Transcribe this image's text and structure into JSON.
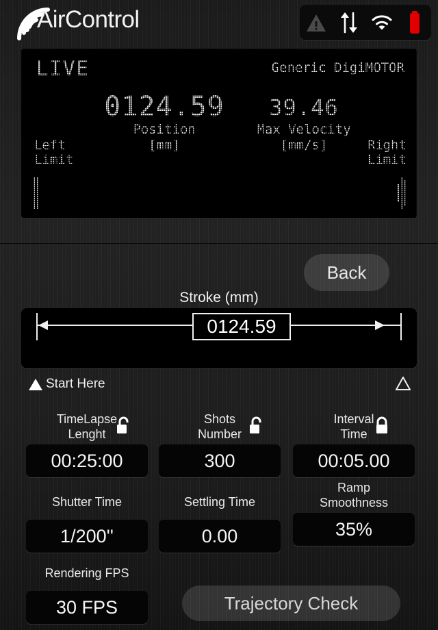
{
  "app": {
    "title": "AirControl",
    "logo_icon": "wifi-arcs-icon"
  },
  "statusbar": {
    "icons": [
      {
        "name": "warning-triangle-icon",
        "color": "#4a4a4a"
      },
      {
        "name": "transfer-arrows-icon",
        "color": "#ffffff"
      },
      {
        "name": "wifi-icon",
        "color": "#ffffff"
      },
      {
        "name": "battery-icon",
        "color": "#e00000"
      }
    ]
  },
  "live_panel": {
    "live_label": "LIVE",
    "motor_name": "Generic DigiMOTOR",
    "position": {
      "value": "0124.59",
      "label": "Position",
      "unit": "[mm]"
    },
    "max_velocity": {
      "value": "39.46",
      "label": "Max Velocity",
      "unit": "[mm/s]"
    },
    "left_limit_line1": "Left",
    "left_limit_line2": "Limit",
    "right_limit_line1": "Right",
    "right_limit_line2": "Limit"
  },
  "nav": {
    "back_label": "Back"
  },
  "stroke": {
    "title": "Stroke (mm)",
    "value": "0124.59"
  },
  "start": {
    "label": "Start Here",
    "start_marker_icon": "filled-triangle-icon",
    "end_marker_icon": "outline-triangle-icon"
  },
  "fields": [
    {
      "name": "timelapse-length",
      "label_line1": "TimeLapse",
      "label_line2": "Lenght",
      "value": "00:25:00",
      "lock_icon": "unlocked-padlock-icon",
      "locked": false
    },
    {
      "name": "shots-number",
      "label_line1": "Shots",
      "label_line2": "Number",
      "value": "300",
      "lock_icon": "unlocked-padlock-icon",
      "locked": false
    },
    {
      "name": "interval-time",
      "label_line1": "Interval",
      "label_line2": "Time",
      "value": "00:05.00",
      "lock_icon": "locked-padlock-icon",
      "locked": true
    },
    {
      "name": "shutter-time",
      "label_line1": "Shutter Time",
      "label_line2": "",
      "value": "1/200''",
      "lock_icon": null,
      "locked": null
    },
    {
      "name": "settling-time",
      "label_line1": "Settling Time",
      "label_line2": "",
      "value": "0.00",
      "lock_icon": null,
      "locked": null
    },
    {
      "name": "ramp-smoothness",
      "label_line1": "Ramp",
      "label_line2": "Smoothness",
      "value": "35%",
      "lock_icon": null,
      "locked": null
    },
    {
      "name": "rendering-fps",
      "label_line1": "Rendering FPS",
      "label_line2": "",
      "value": "30 FPS",
      "lock_icon": null,
      "locked": null
    }
  ],
  "actions": {
    "trajectory_check_label": "Trajectory Check"
  },
  "colors": {
    "accent_red": "#e00000",
    "lcd_text": "#e9e9e9",
    "panel_bg": "#000000",
    "body_bg": "#1d1d1d"
  }
}
